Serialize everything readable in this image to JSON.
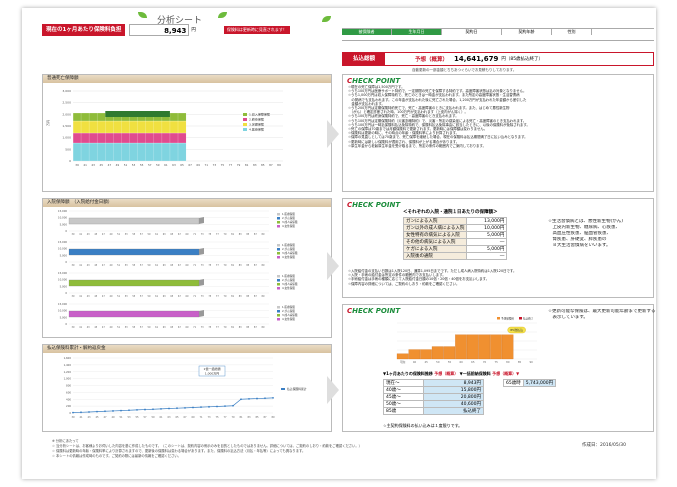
{
  "header": {
    "sheet_title": "分析シート",
    "monthly_label": "現在の1ヶ月あたり保険料負担",
    "monthly_value": "8,943",
    "monthly_unit": "円",
    "warning": "保険料は更新時に見直されます！",
    "table_cols": [
      "被保険者",
      "生年月日",
      "契約日",
      "契約年齢",
      "性別"
    ],
    "total_label": "払込総額",
    "total_sub": "予想（概算）",
    "total_value": "14,641,679",
    "total_unit": "円（85歳払込終了）",
    "total_note": "自動更新の一部金額とちちあつぐらいでお見積もりしております。"
  },
  "panels": {
    "p1_title": "普通死亡保障額",
    "p2_title": "入院保障額　（入院給付金日額）",
    "p3_title": "払込保険料累計・解約返戻金"
  },
  "chart_data": [
    {
      "type": "area",
      "title": "普通死亡保障額",
      "x": [
        "39",
        "41",
        "43",
        "45",
        "47",
        "49",
        "51",
        "53",
        "55",
        "57",
        "59",
        "61",
        "63",
        "65",
        "67",
        "69",
        "71",
        "73",
        "75",
        "77",
        "79",
        "81",
        "83",
        "85",
        "87",
        "89"
      ],
      "series": [
        {
          "name": "1.収入保障保険",
          "color": "#8fbc3a"
        },
        {
          "name": "2.終身保険",
          "color": "#e04b8f"
        },
        {
          "name": "3.定期保険",
          "color": "#f0e040"
        },
        {
          "name": "4.医療保険",
          "color": "#7fd4e0"
        }
      ],
      "ylabel": "万円",
      "ylim": [
        0,
        3000
      ],
      "ytick_labels": [
        "3,000",
        "2,500",
        "2,000",
        "1,500",
        "1,000",
        "500",
        "0"
      ]
    },
    {
      "type": "bar",
      "title": "入院保障額",
      "series": [
        {
          "name": "1.医療保険",
          "color": "#c8c8c8"
        },
        {
          "name": "2.がん保険",
          "color": "#3a7fc4"
        },
        {
          "name": "3.成人病保険",
          "color": "#8fbc3a"
        },
        {
          "name": "4.女性保険",
          "color": "#c860c8"
        }
      ],
      "ylim": [
        0,
        15000
      ],
      "ytick_labels": [
        "15,000",
        "10,000",
        "5,000",
        "0"
      ]
    },
    {
      "type": "line",
      "title": "払込保険料累計",
      "series": [
        {
          "name": "払込保険料累計",
          "color": "#3a7fc4",
          "y": [
            10,
            20,
            30,
            40,
            50,
            60,
            70,
            80,
            90,
            100,
            110,
            120,
            130,
            140,
            150,
            160,
            170,
            180,
            190,
            200,
            210,
            400,
            410,
            420,
            430,
            440
          ]
        }
      ],
      "x": [
        "39",
        "41",
        "43",
        "45",
        "47",
        "49",
        "51",
        "53",
        "55",
        "57",
        "59",
        "61",
        "63",
        "65",
        "67",
        "69",
        "71",
        "73",
        "75",
        "77",
        "79",
        "81",
        "83",
        "85",
        "87",
        "89"
      ],
      "ylim": [
        0,
        1600
      ],
      "ytick_labels": [
        "1,600",
        "1,400",
        "1,200",
        "1,000",
        "800",
        "600",
        "400",
        "200",
        "0"
      ],
      "annotation_line1": "1億一括総額",
      "annotation_line2": "1,000万円"
    },
    {
      "type": "bar",
      "title": "1ヶ月あたりの保険料推移予想（概算）",
      "x": [
        "現在",
        "40",
        "45",
        "50",
        "55",
        "60",
        "65",
        "70",
        "75",
        "80",
        "85",
        "90"
      ],
      "series": [
        {
          "name": "予測保険料",
          "color": "#f09030",
          "values": [
            8943,
            15800,
            15800,
            20800,
            20800,
            40600,
            40600,
            40600,
            40600,
            40600,
            0,
            0
          ]
        }
      ],
      "annotation": "85歳払込",
      "legend": [
        "予測保険料",
        "払込終了"
      ],
      "ylim": [
        0,
        60000
      ]
    }
  ],
  "check1": {
    "title_c": "C",
    "title_rest": "HECK POINT",
    "lines": [
      "☆現在の死亡保障は1,500万円です。",
      "☆うち100万円は医療サポート特約で、一定期間の死亡を保障する特約です。高度障害状態は払の対象となりません。",
      "☆うち1,000万円は収入保障特約で、死亡のときは一時金が支払われます。また所定の高度障害状態・生活習慣病",
      "　の発病でも支払われます。この年金が支払われた後に死亡された場合、1,200万円が支払われた年金額から差引した",
      "　金額が支払われます。",
      "☆うち200万円は定期保険特約死亡で、死亡・高度障害のときに支払われます。また、はじめて悪性新生物",
      "　（がん）と確定診断された時、100万円が支払われます（上皮内がん除く）。",
      "☆うち100万円は終身保険特約で、死亡・高度障害のとき支払われます。",
      "☆うち100万円は定期保険特約（災害割増特約）で、災害・所定の感染症による死亡・高度障害のとき支払われます。",
      "☆うち100万円は一時払保険料払込免除特約で、保険料払込免除事由に該当したときに、以後の保険料が免除されます。",
      "☆死亡の保障は70歳までは月額保険料で更新されます。更新時には保障額は変わりません。",
      "☆保険料は更新の時に、その時点の年齢・保険料率により計算されます。",
      "☆保障の見直しとしては70歳まで、死亡保障を継続した場合、現在の保険料は払込期間満了日に払い込みとなります。",
      "☆更新時には新しい保険料が適用され、保険料が上がる場合があります。",
      "☆厚生年金から老齢厚生年金を受け取るまで、所定の条件の範囲内でご案内しております。"
    ]
  },
  "check2": {
    "title_c": "C",
    "title_rest": "HECK POINT",
    "table_title": "＜それぞれの入院・通院１日あたりの保障額＞",
    "rows": [
      {
        "label": "ガンによる入院",
        "value": "13,000円"
      },
      {
        "label": "ガン以外の成人病による入院",
        "value": "10,000円"
      },
      {
        "label": "女性特有の病気による入院",
        "value": "5,000円"
      },
      {
        "label": "その他の病気による入院",
        "value": "―"
      },
      {
        "label": "ケガによる入院",
        "value": "5,000円"
      },
      {
        "label": "入院後の通院",
        "value": "―"
      }
    ],
    "note_lines": [
      "☆生活習慣病とは、悪性新生物(がん)",
      "　上皮内新生物、糖尿病、心疾患、",
      "　高血圧性疾患、脳血管疾患、",
      "　腎疾患、肝硬変、膵疾患の",
      "　８大生活習慣病をいいます。"
    ],
    "lines": [
      "☆入院給付金の支払い日数は1入院120日、通算1,095日までです。ただし成人病入院特約は1入院120日です。",
      "☆入院・手術の給付金は所定の条件の範囲内でお支払いします。",
      "☆手術給付金は手術の種類に応じて入院給付金日額の10倍・20倍・40倍をお支払いします。",
      "☆保障内容の詳細については、ご契約のしおり・約款をご確認ください。"
    ]
  },
  "check3": {
    "title_c": "C",
    "title_rest": "HECK POINT",
    "note_lines": [
      "☆更新可能な保険は、最大更新可能年齢まで更新するものとして",
      "　表示しています。"
    ],
    "table_title_left": "▼1ヶ月あたりの保険料推移",
    "table_title_mid": "予想（概算）",
    "table_title_right": "▼一括前納保険料",
    "table_title_right2": "予想（概算）▼",
    "rows": [
      {
        "age": "現在〜",
        "value": "8,943円"
      },
      {
        "age": "40歳〜",
        "value": "15,800円"
      },
      {
        "age": "45歳〜",
        "value": "20,800円"
      },
      {
        "age": "50歳〜",
        "value": "40,600円"
      },
      {
        "age": "85歳",
        "value": "払込終了"
      }
    ],
    "lump_age": "65歳時",
    "lump_value": "5,743,000円",
    "footer": "☆主契約保険料の払い込みは１度限りです。"
  },
  "footer": {
    "lines": [
      "※ 分析にあたって",
      "☆ 当分析シートは、お客様よりお伺いした内容を基に作成したものです。（このシートは、契約内容の例示のみを目的としたものではありません。詳細については、ご契約のしおり・約款をご確認ください。）",
      "☆ 保険料は更新時の年齢・保険料率により計算されますので、更新後の保険料は変わる場合があります。また、保険料の払込方法（月払・年払等）によっても異なります。",
      "☆ 本シートの情報は作成時のものです。ご契約の際には最新の情報をご確認ください。"
    ],
    "date_label": "作成日：",
    "date_value": "2016/05/30"
  }
}
